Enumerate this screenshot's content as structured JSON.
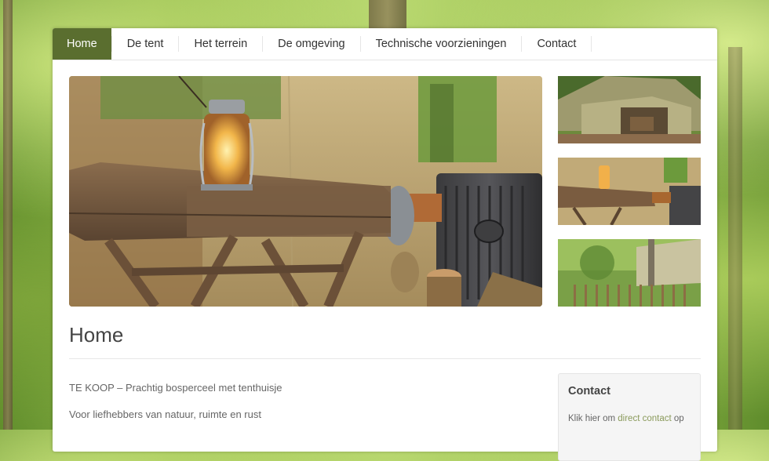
{
  "nav": {
    "items": [
      {
        "label": "Home",
        "active": true
      },
      {
        "label": "De tent"
      },
      {
        "label": "Het terrein"
      },
      {
        "label": "De omgeving"
      },
      {
        "label": "Technische voorzieningen"
      },
      {
        "label": "Contact"
      }
    ],
    "active_color": "#5a6e2f"
  },
  "gallery": {
    "main": {
      "icon": "photo-lantern-tray-stove"
    },
    "thumbs": [
      {
        "icon": "photo-tent-exterior"
      },
      {
        "icon": "photo-lantern-tray-stove"
      },
      {
        "icon": "photo-woodland-fence"
      }
    ]
  },
  "page": {
    "title": "Home",
    "paragraphs": [
      "TE KOOP – Prachtig bosperceel met tenthuisje",
      "Voor liefhebbers van natuur, ruimte en rust"
    ]
  },
  "sidebar": {
    "widget_title": "Contact",
    "text_prefix": "Klik hier om ",
    "link_text": "direct contact",
    "text_suffix": " op"
  }
}
